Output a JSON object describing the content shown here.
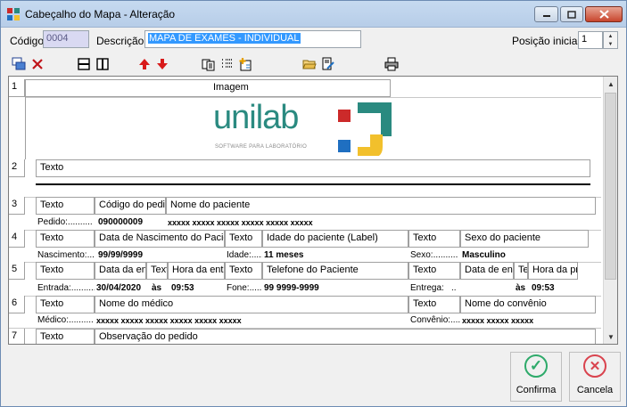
{
  "window": {
    "title": "Cabeçalho do Mapa - Alteração",
    "accent": "#3399ff",
    "min_icon": "minimize-icon",
    "max_icon": "maximize-icon",
    "close_icon": "close-icon"
  },
  "form": {
    "code_label": "Código",
    "code_value": "0004",
    "desc_label": "Descrição",
    "desc_value": "MAPA DE EXAMES - INDIVIDUAL",
    "pos_label": "Posição inicial",
    "pos_value": "1"
  },
  "toolbar": {
    "icons": [
      "insert-row-icon",
      "delete-icon",
      "split-horizontal-icon",
      "split-vertical-icon",
      "arrow-up-icon",
      "arrow-down-icon",
      "copy-icon",
      "list-icon",
      "add-field-icon",
      "open-folder-icon",
      "edit-document-icon",
      "print-icon"
    ]
  },
  "grid": {
    "rows": [
      {
        "num": "1",
        "cells": [
          "Imagem"
        ]
      },
      {
        "num": "2",
        "cells": [
          "Texto"
        ]
      },
      {
        "num": "3",
        "cells": [
          "Texto",
          "Código do pedido",
          "Nome do paciente"
        ],
        "sub": [
          "Pedido:..........",
          "090000009",
          "xxxxx xxxxx xxxxx xxxxx xxxxx xxxxx"
        ]
      },
      {
        "num": "4",
        "cells": [
          "Texto",
          "Data de Nascimento do Paciente",
          "Texto",
          "Idade do paciente (Label)",
          "Texto",
          "Sexo do paciente"
        ],
        "sub": [
          "Nascimento:.......",
          "99/99/9999",
          "Idade:.........",
          "11 meses",
          "Sexo:..........",
          "Masculino"
        ]
      },
      {
        "num": "5",
        "cells": [
          "Texto",
          "Data da entrada",
          "Texto",
          "Hora da entrada",
          "Texto",
          "Telefone do Paciente",
          "Texto",
          "Data de entrega",
          "Texto",
          "Hora da previsão"
        ],
        "sub": [
          "Entrada:..........",
          "30/04/2020",
          "às",
          "09:53",
          "Fone:..........",
          "99 9999-9999",
          "Entrega:",
          "..",
          "às",
          "09:53"
        ]
      },
      {
        "num": "6",
        "cells": [
          "Texto",
          "Nome do médico",
          "Texto",
          "Nome do convênio"
        ],
        "sub": [
          "Médico:..........",
          "xxxxx xxxxx xxxxx xxxxx xxxxx xxxxx",
          "Convênio:.........",
          "xxxxx xxxxx xxxxx"
        ]
      },
      {
        "num": "7",
        "cells": [
          "Texto",
          "Observação do pedido"
        ]
      }
    ],
    "logo": {
      "brand": "unilab",
      "tagline": "SOFTWARE PARA LABORATÓRIO",
      "colors": {
        "text": "#2a8a80",
        "red": "#cc2a2a",
        "green": "#2a8a80",
        "blue": "#1f6fc1",
        "yellow": "#f2c02c"
      }
    }
  },
  "actions": {
    "confirm_label": "Confirma",
    "cancel_label": "Cancela",
    "confirm_icon": "check-icon",
    "cancel_icon": "cancel-icon",
    "confirm_color": "#2eaa6a",
    "cancel_color": "#d9434e"
  }
}
